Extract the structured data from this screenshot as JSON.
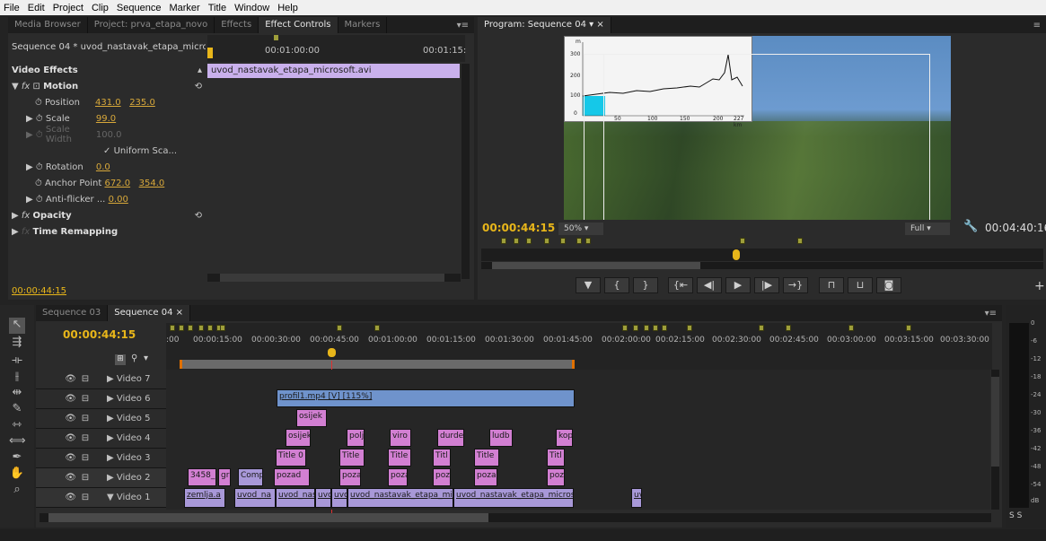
{
  "menu": [
    "File",
    "Edit",
    "Project",
    "Clip",
    "Sequence",
    "Marker",
    "Title",
    "Window",
    "Help"
  ],
  "source_panel": {
    "tabs": [
      "Media Browser",
      "Project: prva_etapa_novo",
      "Effects",
      "Effect Controls",
      "Markers"
    ],
    "sequence_label": "Sequence 04 * uvod_nastavak_etapa_micro...",
    "time_a": "00:01:00:00",
    "time_b": "00:01:15:",
    "clip_name": "uvod_nastavak_etapa_microsoft.avi",
    "video_effects": "Video Effects",
    "motion": "Motion",
    "position_label": "Position",
    "position_x": "431.0",
    "position_y": "235.0",
    "scale_label": "Scale",
    "scale_val": "99.0",
    "scale_width_label": "Scale Width",
    "scale_width_val": "100.0",
    "uniform": "Uniform Sca...",
    "rotation_label": "Rotation",
    "rotation_val": "0.0",
    "anchor_label": "Anchor Point",
    "anchor_x": "672.0",
    "anchor_y": "354.0",
    "antiflicker_label": "Anti-flicker ...",
    "antiflicker_val": "0.00",
    "opacity": "Opacity",
    "time_remap": "Time Remapping",
    "current_time": "00:00:44:15"
  },
  "program": {
    "tab": "Program: Sequence 04",
    "timecode": "00:00:44:15",
    "zoom": "50%",
    "quality": "Full",
    "duration": "00:04:40:16",
    "chart_unit": "m",
    "chart_y": [
      "300",
      "200",
      "100",
      "0"
    ],
    "chart_x": [
      "50",
      "100",
      "150",
      "200",
      "227 km"
    ]
  },
  "timeline": {
    "tabs": [
      "Sequence 03",
      "Sequence 04"
    ],
    "timecode": "00:00:44:15",
    "ruler": [
      ":00",
      "00:00:15:00",
      "00:00:30:00",
      "00:00:45:00",
      "00:01:00:00",
      "00:01:15:00",
      "00:01:30:00",
      "00:01:45:00",
      "00:02:00:00",
      "00:02:15:00",
      "00:02:30:00",
      "00:02:45:00",
      "00:03:00:00",
      "00:03:15:00",
      "00:03:30:00"
    ],
    "tracks": [
      "Video 7",
      "Video 6",
      "Video 5",
      "Video 4",
      "Video 3",
      "Video 2",
      "Video 1"
    ],
    "clips": {
      "v6": "profil1.mp4 [V] [115%]",
      "v5": "osijek",
      "v4a": "osijek",
      "v4b": "polj",
      "v4c": "viro",
      "v4d": "durde",
      "v4e": "ludb",
      "v4f": "kop",
      "v3a": "Title 0",
      "v3b": "Title",
      "v3c": "Title",
      "v3d": "Titl",
      "v3e": "Title",
      "v3f": "Titl",
      "v2a": "3458_",
      "v2b": "gr",
      "v2c": "Comp",
      "v2d": "pozad",
      "v2e": "poza",
      "v2f": "poza",
      "v2g": "poz",
      "v2h": "poza",
      "v2i": "poz",
      "v1a": "zemlja.a",
      "v1b": "uvod_na",
      "v1c": "uvod_nas",
      "v1d": "uvc",
      "v1e": "uvc",
      "v1f": "uvod_nastavak_etapa_mic",
      "v1g": "uvod_nastavak_etapa_micros",
      "v1h": "uv"
    },
    "meter_scale": [
      "0",
      "-6",
      "-12",
      "-18",
      "-24",
      "-30",
      "-36",
      "-42",
      "-48",
      "-54",
      "dB"
    ],
    "solo": "S S"
  }
}
